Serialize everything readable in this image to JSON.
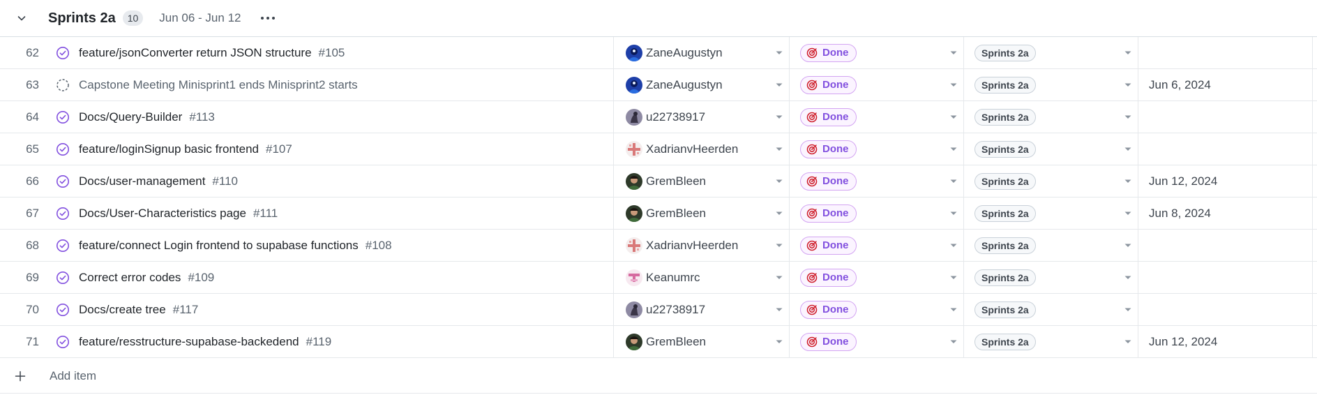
{
  "group": {
    "title": "Sprints 2a",
    "count": "10",
    "date_range": "Jun 06 - Jun 12"
  },
  "colors": {
    "done_accent": "#8250df",
    "done_bg": "#fbf4ff",
    "target_icon_red": "#cf222e",
    "muted_text": "#59636e"
  },
  "rows": [
    {
      "num": "62",
      "state": "closed-issue-icon",
      "title": "feature/jsonConverter return JSON structure",
      "issue": "#105",
      "assignee": "ZaneAugustyn",
      "avatar": "zane",
      "status": "Done",
      "iteration": "Sprints 2a",
      "date": ""
    },
    {
      "num": "63",
      "state": "draft-issue-icon",
      "title": "Capstone Meeting Minisprint1 ends Minisprint2 starts",
      "issue": "",
      "assignee": "ZaneAugustyn",
      "avatar": "zane",
      "status": "Done",
      "iteration": "Sprints 2a",
      "date": "Jun 6, 2024"
    },
    {
      "num": "64",
      "state": "closed-issue-icon",
      "title": "Docs/Query-Builder",
      "issue": "#113",
      "assignee": "u22738917",
      "avatar": "u227",
      "status": "Done",
      "iteration": "Sprints 2a",
      "date": ""
    },
    {
      "num": "65",
      "state": "closed-issue-icon",
      "title": "feature/loginSignup basic frontend",
      "issue": "#107",
      "assignee": "XadrianvHeerden",
      "avatar": "xadrian",
      "status": "Done",
      "iteration": "Sprints 2a",
      "date": ""
    },
    {
      "num": "66",
      "state": "closed-issue-icon",
      "title": "Docs/user-management",
      "issue": "#110",
      "assignee": "GremBleen",
      "avatar": "grem",
      "status": "Done",
      "iteration": "Sprints 2a",
      "date": "Jun 12, 2024"
    },
    {
      "num": "67",
      "state": "closed-issue-icon",
      "title": "Docs/User-Characteristics page",
      "issue": "#111",
      "assignee": "GremBleen",
      "avatar": "grem",
      "status": "Done",
      "iteration": "Sprints 2a",
      "date": "Jun 8, 2024"
    },
    {
      "num": "68",
      "state": "closed-issue-icon",
      "title": "feature/connect Login frontend to supabase functions",
      "issue": "#108",
      "assignee": "XadrianvHeerden",
      "avatar": "xadrian",
      "status": "Done",
      "iteration": "Sprints 2a",
      "date": ""
    },
    {
      "num": "69",
      "state": "closed-issue-icon",
      "title": "Correct error codes",
      "issue": "#109",
      "assignee": "Keanumrc",
      "avatar": "keanu",
      "status": "Done",
      "iteration": "Sprints 2a",
      "date": ""
    },
    {
      "num": "70",
      "state": "closed-issue-icon",
      "title": "Docs/create tree",
      "issue": "#117",
      "assignee": "u22738917",
      "avatar": "u227",
      "status": "Done",
      "iteration": "Sprints 2a",
      "date": ""
    },
    {
      "num": "71",
      "state": "closed-issue-icon",
      "title": "feature/resstructure-supabase-backedend",
      "issue": "#119",
      "assignee": "GremBleen",
      "avatar": "grem",
      "status": "Done",
      "iteration": "Sprints 2a",
      "date": "Jun 12, 2024"
    }
  ],
  "add_item": {
    "label": "Add item"
  }
}
